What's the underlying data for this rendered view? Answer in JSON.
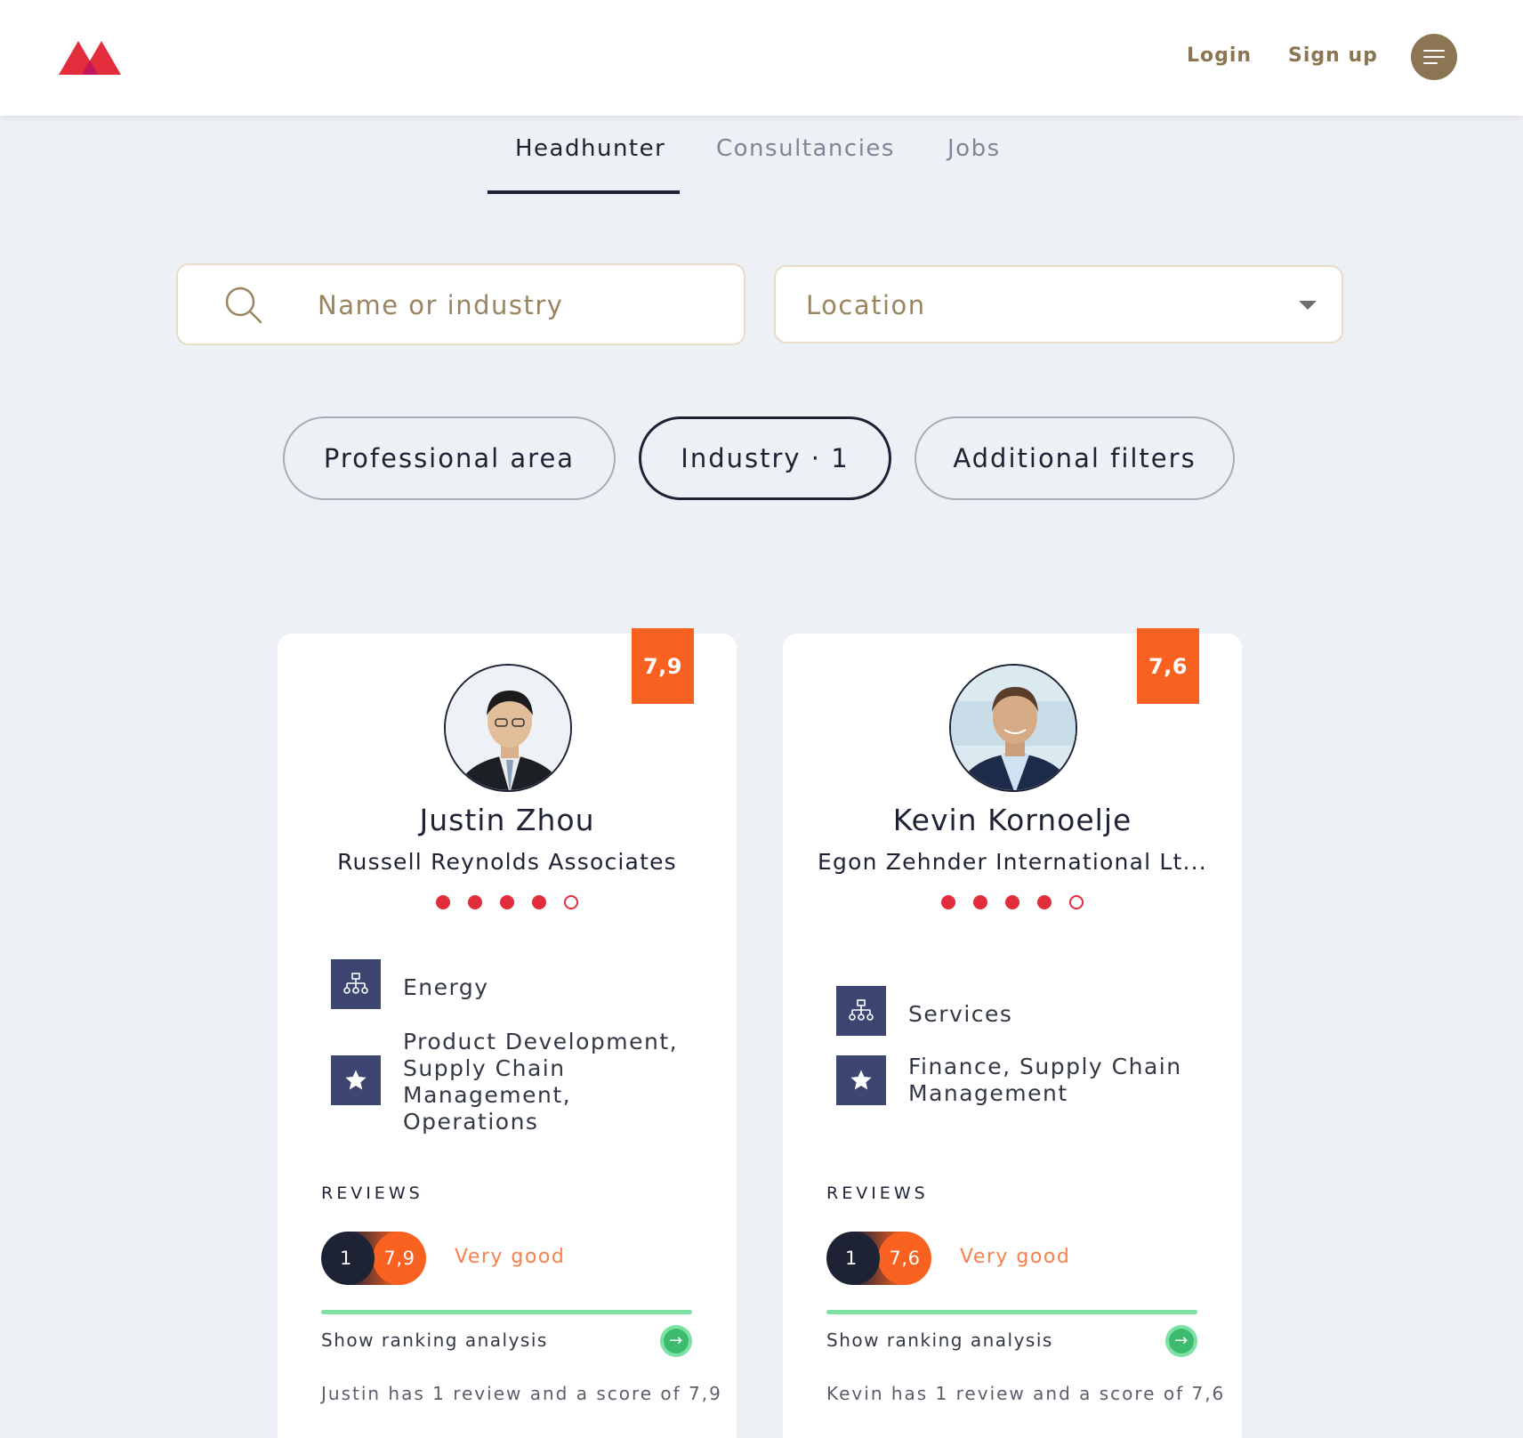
{
  "header": {
    "login_label": "Login",
    "signup_label": "Sign up",
    "brand_colors": [
      "#e22d3c",
      "#c2185b"
    ],
    "menu_icon": "hamburger-icon"
  },
  "tabs": [
    {
      "label": "Headhunter",
      "active": true
    },
    {
      "label": "Consultancies",
      "active": false
    },
    {
      "label": "Jobs",
      "active": false
    }
  ],
  "search": {
    "placeholder": "Name or industry",
    "icon": "search-icon"
  },
  "location": {
    "placeholder": "Location",
    "icon": "chevron-down-icon"
  },
  "filters": [
    {
      "label": "Professional area",
      "active": false
    },
    {
      "label": "Industry · 1",
      "active": true
    },
    {
      "label": "Additional filters",
      "active": false
    }
  ],
  "cards": [
    {
      "score": "7,9",
      "name": "Justin Zhou",
      "company": "Russell Reynolds Associates",
      "rating_filled": 4,
      "rating_total": 5,
      "industry": "Energy",
      "expertise": "Product Development, Supply Chain Management, Operations",
      "reviews_label": "REVIEWS",
      "review_count": "1",
      "review_score": "7,9",
      "verdict": "Very good",
      "ranking_link": "Show ranking analysis",
      "summary": "Justin has 1 review and a score of 7,9"
    },
    {
      "score": "7,6",
      "name": "Kevin Kornoelje",
      "company": "Egon Zehnder International Lt...",
      "rating_filled": 4,
      "rating_total": 5,
      "industry": "Services",
      "expertise": "Finance, Supply Chain Management",
      "reviews_label": "REVIEWS",
      "review_count": "1",
      "review_score": "7,6",
      "verdict": "Very good",
      "ranking_link": "Show ranking analysis",
      "summary": "Kevin has 1 review and a score of 7,6"
    }
  ],
  "colors": {
    "accent_gold": "#8b7553",
    "score_orange": "#f86120",
    "dot_red": "#e22d3c",
    "navy": "#1e2235",
    "icon_bg": "#3d4670",
    "green": "#7de1a4"
  }
}
